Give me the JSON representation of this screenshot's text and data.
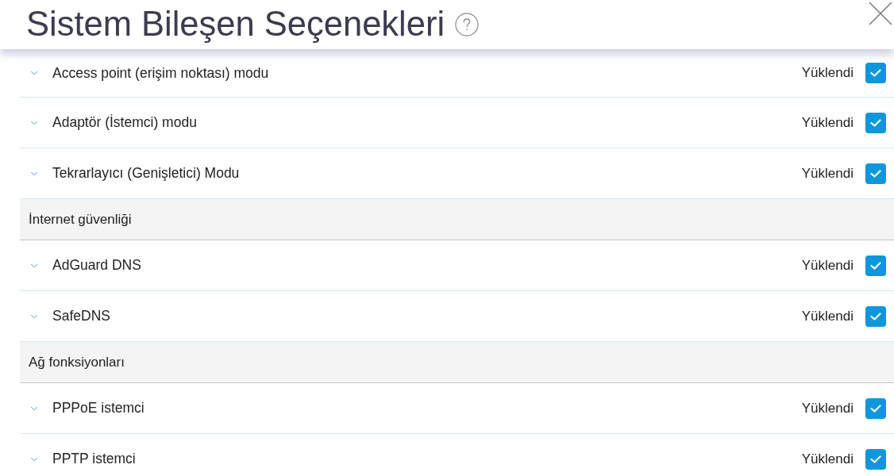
{
  "dialog": {
    "title": "Sistem Bileşen Seçenekleri"
  },
  "items": [
    {
      "kind": "component",
      "name": "Access point (erişim noktası) modu",
      "status": "Yüklendi",
      "checked": true
    },
    {
      "kind": "component",
      "name": "Adaptör (İstemci) modu",
      "status": "Yüklendi",
      "checked": true
    },
    {
      "kind": "component",
      "name": "Tekrarlayıcı (Genişletici) Modu",
      "status": "Yüklendi",
      "checked": true
    },
    {
      "kind": "section",
      "label": "İnternet güvenliği"
    },
    {
      "kind": "component",
      "name": "AdGuard DNS",
      "status": "Yüklendi",
      "checked": true
    },
    {
      "kind": "component",
      "name": "SafeDNS",
      "status": "Yüklendi",
      "checked": true
    },
    {
      "kind": "section",
      "label": "Ağ fonksiyonları"
    },
    {
      "kind": "component",
      "name": "PPPoE istemci",
      "status": "Yüklendi",
      "checked": true
    },
    {
      "kind": "component",
      "name": "PPTP istemci",
      "status": "Yüklendi",
      "checked": true
    }
  ]
}
